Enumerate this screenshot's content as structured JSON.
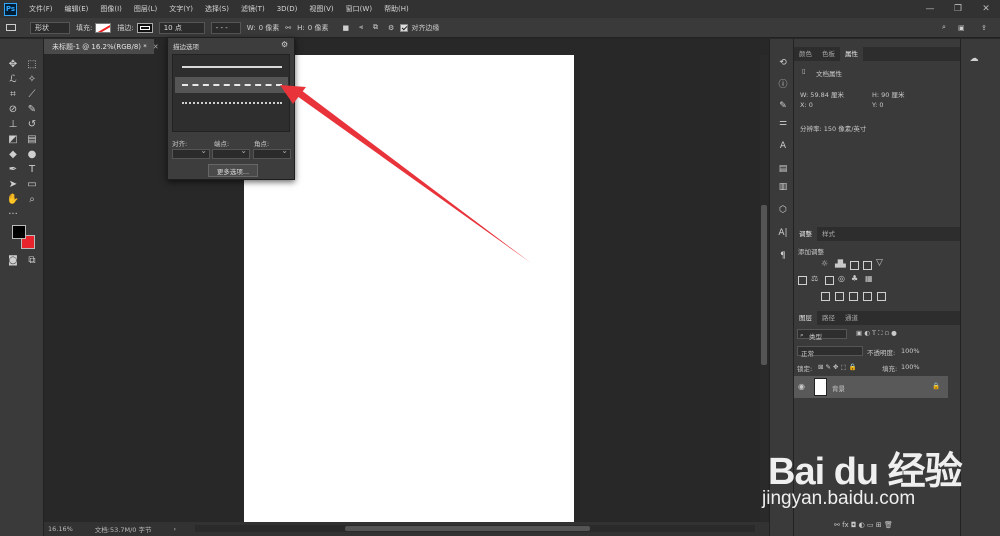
{
  "app": {
    "logo": "Ps"
  },
  "menu": [
    "文件(F)",
    "编辑(E)",
    "图像(I)",
    "图层(L)",
    "文字(Y)",
    "选择(S)",
    "滤镜(T)",
    "3D(D)",
    "视图(V)",
    "窗口(W)",
    "帮助(H)"
  ],
  "options": {
    "mode": "形状",
    "fill_label": "填充:",
    "stroke_label": "描边:",
    "stroke_size": "10 点",
    "w_label": "W:",
    "w_value": "0 像素",
    "h_label": "H:",
    "h_value": "0 像素",
    "align_edges": "对齐边缘"
  },
  "document": {
    "tab_title": "未标题-1 @ 16.2%(RGB/8) *",
    "zoom": "16.16%",
    "doc_info": "文档:53.7M/0 字节"
  },
  "stroke_popup": {
    "title": "描边选项",
    "align_label": "对齐:",
    "caps_label": "端点:",
    "corners_label": "角点:",
    "more_button": "更多选项..."
  },
  "properties": {
    "tabs": [
      "颜色",
      "色板",
      "属性"
    ],
    "doc_props": "文档属性",
    "w": "W:  59.84 厘米",
    "h": "H:  90 厘米",
    "x": "X:  0",
    "y": "Y:  0",
    "resolution": "分辨率: 150 像素/英寸"
  },
  "adjustments": {
    "tabs": [
      "调整",
      "样式"
    ],
    "add_label": "添加调整"
  },
  "layers": {
    "tabs": [
      "图层",
      "路径",
      "通道"
    ],
    "kind": "类型",
    "blend": "正常",
    "opacity_label": "不透明度:",
    "opacity": "100%",
    "lock_label": "锁定:",
    "fill_label": "填充:",
    "fill": "100%",
    "layer_name": "背景"
  },
  "watermark": {
    "brand": "Bai du 经验",
    "url": "jingyan.baidu.com"
  },
  "colors": {
    "accent": "#31a8ff",
    "arrow": "#e8333a",
    "foreground": "#000000",
    "background": "#e8232b"
  }
}
